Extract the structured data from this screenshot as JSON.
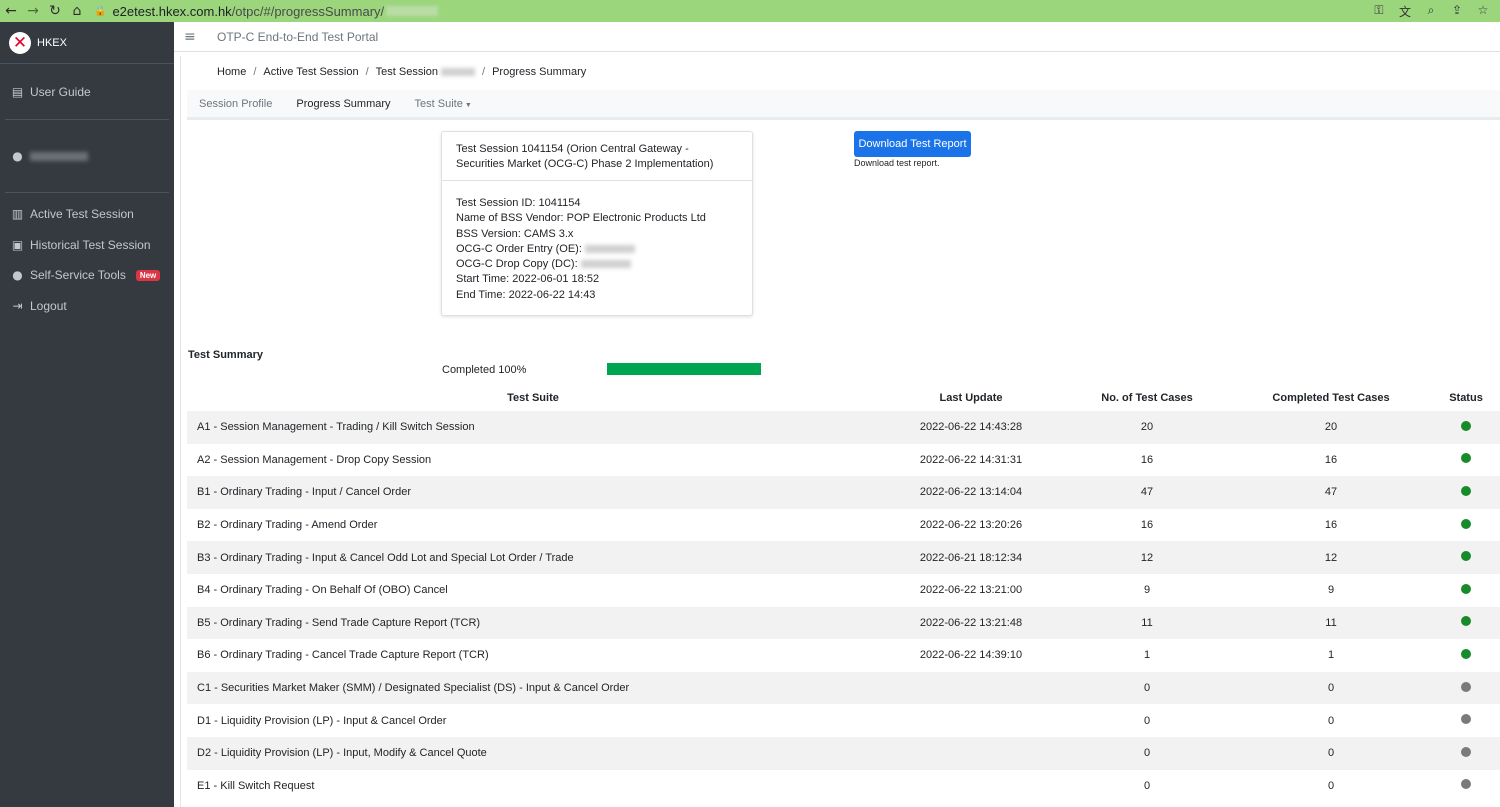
{
  "browser": {
    "url_host": "e2etest.hkex.com.hk",
    "url_path": "/otpc/#/progressSummary/"
  },
  "sidebar": {
    "brand": "HKEX",
    "user_guide": "User Guide",
    "items": [
      {
        "label": "Active Test Session"
      },
      {
        "label": "Historical Test Session"
      },
      {
        "label": "Self-Service Tools",
        "badge": "New"
      },
      {
        "label": "Logout"
      }
    ]
  },
  "header": {
    "title": "OTP-C End-to-End Test Portal"
  },
  "breadcrumb": {
    "home": "Home",
    "active": "Active Test Session",
    "session": "Test Session",
    "current": "Progress Summary"
  },
  "tabs": [
    {
      "label": "Session Profile"
    },
    {
      "label": "Progress Summary"
    },
    {
      "label": "Test Suite"
    }
  ],
  "card": {
    "header": "Test Session 1041154 (Orion Central Gateway - Securities Market (OCG-C) Phase 2 Implementation)",
    "session_id": "Test Session ID: 1041154",
    "vendor": "Name of BSS Vendor: POP Electronic Products Ltd",
    "bss_version": "BSS Version: CAMS 3.x",
    "order_entry": "OCG-C Order Entry (OE):",
    "drop_copy": "OCG-C Drop Copy (DC):",
    "start_time": "Start Time: 2022-06-01 18:52",
    "end_time": "End Time: 2022-06-22 14:43"
  },
  "download": {
    "button": "Download Test Report",
    "note": "Download test report."
  },
  "summary": {
    "title": "Test Summary",
    "completed_label": "Completed 100%",
    "progress": 1.0,
    "progress_color": "#00a54f",
    "headers": [
      "Test Suite",
      "Last Update",
      "No. of Test Cases",
      "Completed Test Cases",
      "Status"
    ],
    "rows": [
      {
        "suite": "A1 - Session Management - Trading / Kill Switch Session",
        "updated": "2022-06-22 14:43:28",
        "total": "20",
        "completed": "20",
        "status": "done"
      },
      {
        "suite": "A2 - Session Management - Drop Copy Session",
        "updated": "2022-06-22 14:31:31",
        "total": "16",
        "completed": "16",
        "status": "done"
      },
      {
        "suite": "B1 - Ordinary Trading - Input / Cancel Order",
        "updated": "2022-06-22 13:14:04",
        "total": "47",
        "completed": "47",
        "status": "done"
      },
      {
        "suite": "B2 - Ordinary Trading - Amend Order",
        "updated": "2022-06-22 13:20:26",
        "total": "16",
        "completed": "16",
        "status": "done"
      },
      {
        "suite": "B3 - Ordinary Trading - Input & Cancel Odd Lot and Special Lot Order / Trade",
        "updated": "2022-06-21 18:12:34",
        "total": "12",
        "completed": "12",
        "status": "done"
      },
      {
        "suite": "B4 - Ordinary Trading - On Behalf Of (OBO) Cancel",
        "updated": "2022-06-22 13:21:00",
        "total": "9",
        "completed": "9",
        "status": "done"
      },
      {
        "suite": "B5 - Ordinary Trading - Send Trade Capture Report (TCR)",
        "updated": "2022-06-22 13:21:48",
        "total": "11",
        "completed": "11",
        "status": "done"
      },
      {
        "suite": "B6 - Ordinary Trading - Cancel Trade Capture Report (TCR)",
        "updated": "2022-06-22 14:39:10",
        "total": "1",
        "completed": "1",
        "status": "done"
      },
      {
        "suite": "C1 - Securities Market Maker (SMM) / Designated Specialist (DS) - Input & Cancel Order",
        "updated": "",
        "total": "0",
        "completed": "0",
        "status": "none"
      },
      {
        "suite": "D1 - Liquidity Provision (LP) - Input & Cancel Order",
        "updated": "",
        "total": "0",
        "completed": "0",
        "status": "none"
      },
      {
        "suite": "D2 - Liquidity Provision (LP) - Input, Modify & Cancel Quote",
        "updated": "",
        "total": "0",
        "completed": "0",
        "status": "none"
      },
      {
        "suite": "E1 - Kill Switch Request",
        "updated": "",
        "total": "0",
        "completed": "0",
        "status": "none"
      }
    ],
    "status_colors": {
      "done": "#198a2a",
      "none": "#7a7a7a"
    }
  }
}
